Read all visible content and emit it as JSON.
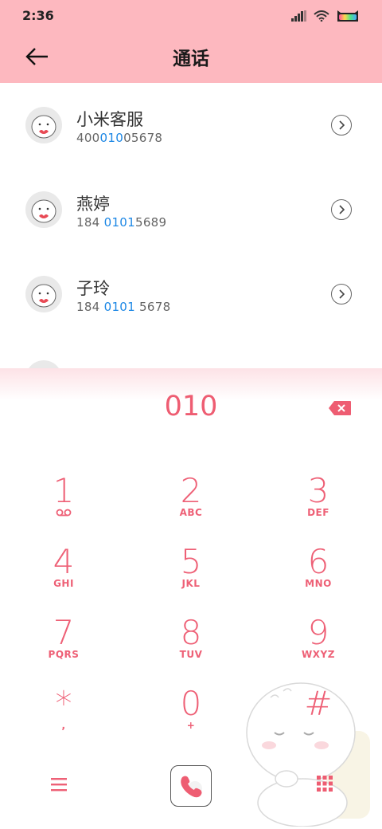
{
  "status": {
    "time": "2:36"
  },
  "header": {
    "title": "通话"
  },
  "contacts": [
    {
      "name": "小米客服",
      "num_pre": "400",
      "num_hl": "010",
      "num_post": "05678"
    },
    {
      "name": "燕婷",
      "num_pre": "184 ",
      "num_hl": "0101",
      "num_post": "5689"
    },
    {
      "name": "子玲",
      "num_pre": "184 ",
      "num_hl": "0101",
      "num_post": " 5678"
    }
  ],
  "dialer": {
    "entered": "010",
    "keys": [
      {
        "num": "1",
        "letters": ""
      },
      {
        "num": "2",
        "letters": "ABC"
      },
      {
        "num": "3",
        "letters": "DEF"
      },
      {
        "num": "4",
        "letters": "GHI"
      },
      {
        "num": "5",
        "letters": "JKL"
      },
      {
        "num": "6",
        "letters": "MNO"
      },
      {
        "num": "7",
        "letters": "PQRS"
      },
      {
        "num": "8",
        "letters": "TUV"
      },
      {
        "num": "9",
        "letters": "WXYZ"
      },
      {
        "num": "*",
        "letters": ","
      },
      {
        "num": "0",
        "letters": "+"
      },
      {
        "num": "#",
        "letters": ""
      }
    ]
  },
  "colors": {
    "accent": "#ee6076",
    "header_bg": "#fdb8bf",
    "highlight": "#1e88e5"
  },
  "icons": [
    "back-arrow-icon",
    "detail-chevron-icon",
    "backspace-icon",
    "voicemail-icon",
    "menu-icon",
    "phone-icon",
    "keypad-icon",
    "signal-icon",
    "wifi-icon",
    "battery-icon"
  ]
}
